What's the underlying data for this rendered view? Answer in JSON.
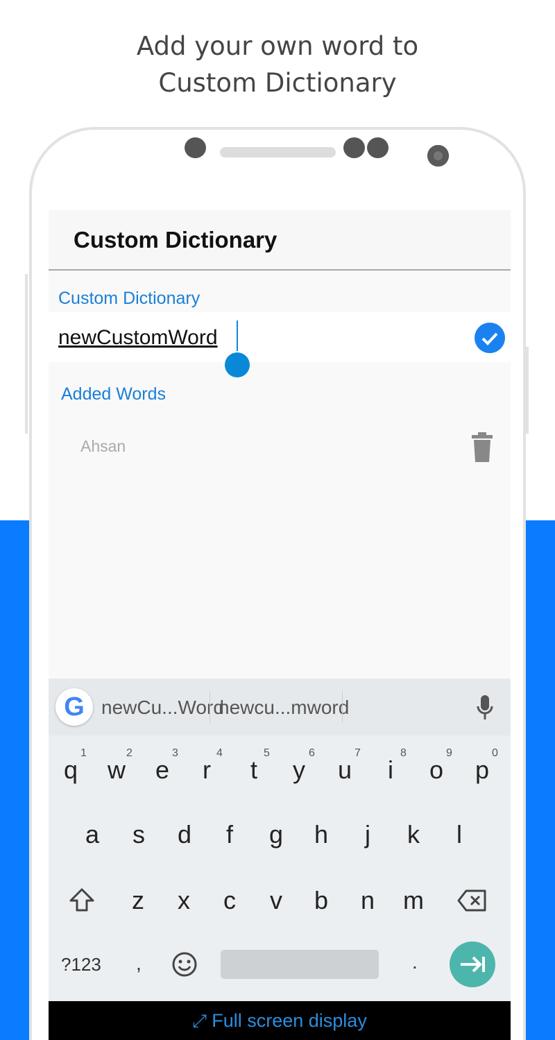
{
  "headline": {
    "line1": "Add your own word to",
    "line2": "Custom Dictionary"
  },
  "app_bar": {
    "title": "Custom Dictionary"
  },
  "form": {
    "label": "Custom Dictionary",
    "value": "newCustomWord",
    "confirm_icon": "check-circle-icon"
  },
  "added_words": {
    "heading": "Added Words",
    "items": [
      {
        "word": "Ahsan",
        "action_icon": "trash-icon"
      }
    ]
  },
  "keyboard": {
    "suggestions": [
      "newCu...Word",
      "newcu...mword"
    ],
    "row1": [
      "q",
      "w",
      "e",
      "r",
      "t",
      "y",
      "u",
      "i",
      "o",
      "p"
    ],
    "row1_hints": [
      "1",
      "2",
      "3",
      "4",
      "5",
      "6",
      "7",
      "8",
      "9",
      "0"
    ],
    "row2": [
      "a",
      "s",
      "d",
      "f",
      "g",
      "h",
      "j",
      "k",
      "l"
    ],
    "row3": [
      "z",
      "x",
      "c",
      "v",
      "b",
      "n",
      "m"
    ],
    "symbols_label": "?123",
    "comma": ",",
    "period": "."
  },
  "fullscreen_bar": {
    "label": "Full screen display"
  },
  "colors": {
    "brand_blue": "#0a7cff",
    "accent": "#1a7fd6",
    "enter": "#4db6ac"
  }
}
